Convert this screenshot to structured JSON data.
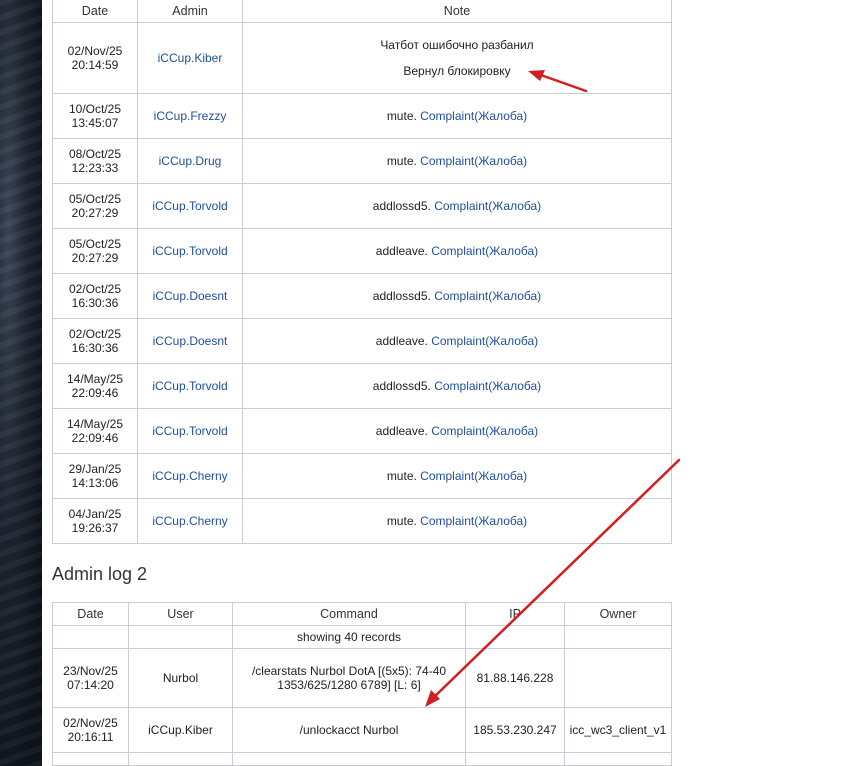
{
  "admin_log": {
    "headers": [
      "Date",
      "Admin",
      "Note"
    ],
    "rows": [
      {
        "date": "02/Nov/25",
        "time": "20:14:59",
        "admin": "iCCup.Kiber",
        "note": [
          "Чатбот ошибочно разбанил",
          "Вернул блокировку"
        ]
      },
      {
        "date": "10/Oct/25",
        "time": "13:45:07",
        "admin": "iCCup.Frezzy",
        "prefix": "mute.",
        "link": "Complaint(Жалоба)"
      },
      {
        "date": "08/Oct/25",
        "time": "12:23:33",
        "admin": "iCCup.Drug",
        "prefix": "mute.",
        "link": "Complaint(Жалоба)"
      },
      {
        "date": "05/Oct/25",
        "time": "20:27:29",
        "admin": "iCCup.Torvold",
        "prefix": "addlossd5.",
        "link": "Complaint(Жалоба)"
      },
      {
        "date": "05/Oct/25",
        "time": "20:27:29",
        "admin": "iCCup.Torvold",
        "prefix": "addleave.",
        "link": "Complaint(Жалоба)"
      },
      {
        "date": "02/Oct/25",
        "time": "16:30:36",
        "admin": "iCCup.Doesnt",
        "prefix": "addlossd5.",
        "link": "Complaint(Жалоба)"
      },
      {
        "date": "02/Oct/25",
        "time": "16:30:36",
        "admin": "iCCup.Doesnt",
        "prefix": "addleave.",
        "link": "Complaint(Жалоба)"
      },
      {
        "date": "14/May/25",
        "time": "22:09:46",
        "admin": "iCCup.Torvold",
        "prefix": "addlossd5.",
        "link": "Complaint(Жалоба)"
      },
      {
        "date": "14/May/25",
        "time": "22:09:46",
        "admin": "iCCup.Torvold",
        "prefix": "addleave.",
        "link": "Complaint(Жалоба)"
      },
      {
        "date": "29/Jan/25",
        "time": "14:13:06",
        "admin": "iCCup.Cherny",
        "prefix": "mute.",
        "link": "Complaint(Жалоба)"
      },
      {
        "date": "04/Jan/25",
        "time": "19:26:37",
        "admin": "iCCup.Cherny",
        "prefix": "mute.",
        "link": "Complaint(Жалоба)"
      }
    ]
  },
  "admin_log_2": {
    "title": "Admin log 2",
    "headers": [
      "Date",
      "User",
      "Command",
      "IP",
      "Owner"
    ],
    "records_text": "showing 40 records",
    "rows": [
      {
        "date": "23/Nov/25",
        "time": "07:14:20",
        "user": "Nurbol",
        "command": [
          "/clearstats Nurbol DotA [(5x5): 74-40",
          "1353/625/1280 6789] [L: 6]"
        ],
        "ip": "81.88.146.228",
        "owner": ""
      },
      {
        "date": "02/Nov/25",
        "time": "20:16:11",
        "user": "iCCup.Kiber",
        "command": [
          "/unlockacct Nurbol"
        ],
        "ip": "185.53.230.247",
        "owner": "icc_wc3_client_v1"
      }
    ]
  },
  "colors": {
    "link": "#1f4e9c",
    "arrow": "#d11f1f",
    "border": "#c9ced6"
  }
}
